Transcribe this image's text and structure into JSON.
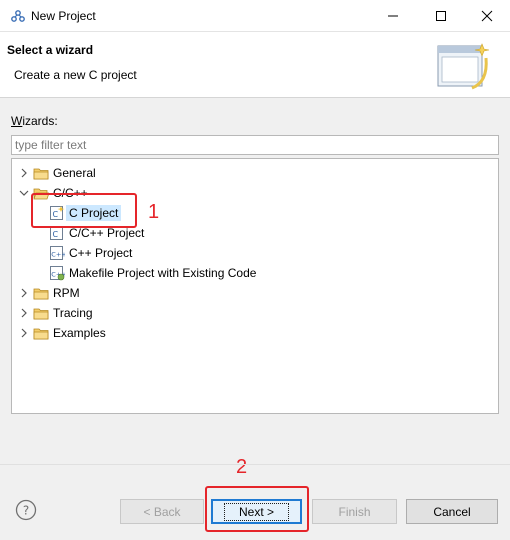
{
  "window": {
    "title": "New Project",
    "icon": "eclipse-app-icon",
    "controls": [
      "minimize-icon",
      "maximize-icon",
      "close-icon"
    ]
  },
  "banner": {
    "title": "Select a wizard",
    "description": "Create a new C project",
    "image": "wizard-banner-icon"
  },
  "wizards": {
    "label_mnemonic": "W",
    "label_rest": "izards:",
    "filter_placeholder": "type filter text"
  },
  "tree": {
    "items": [
      {
        "label": "General",
        "icon": "folder-icon",
        "expandable": true,
        "expanded": false,
        "level": 0
      },
      {
        "label": "C/C++",
        "icon": "folder-icon",
        "expandable": true,
        "expanded": true,
        "level": 0
      },
      {
        "label": "C Project",
        "icon": "c-project-icon",
        "expandable": false,
        "level": 1,
        "selected": true
      },
      {
        "label": "C/C++ Project",
        "icon": "c-cpp-project-icon",
        "expandable": false,
        "level": 1
      },
      {
        "label": "C++ Project",
        "icon": "cpp-project-icon",
        "expandable": false,
        "level": 1
      },
      {
        "label": "Makefile Project with Existing Code",
        "icon": "makefile-project-icon",
        "expandable": false,
        "level": 1
      },
      {
        "label": "RPM",
        "icon": "folder-icon",
        "expandable": true,
        "expanded": false,
        "level": 0
      },
      {
        "label": "Tracing",
        "icon": "folder-icon",
        "expandable": true,
        "expanded": false,
        "level": 0
      },
      {
        "label": "Examples",
        "icon": "folder-icon",
        "expandable": true,
        "expanded": false,
        "level": 0
      }
    ]
  },
  "annotations": {
    "step1": "1",
    "step2": "2",
    "color": "#e5252a"
  },
  "buttons": {
    "help_icon": "help-icon",
    "back_mnemonic": "< ",
    "back_label": "< Back",
    "next_label": "Next >",
    "finish_label": "Finish",
    "cancel_label": "Cancel"
  },
  "colors": {
    "selection": "#cce8ff",
    "default_button_border": "#1f7ad2"
  }
}
